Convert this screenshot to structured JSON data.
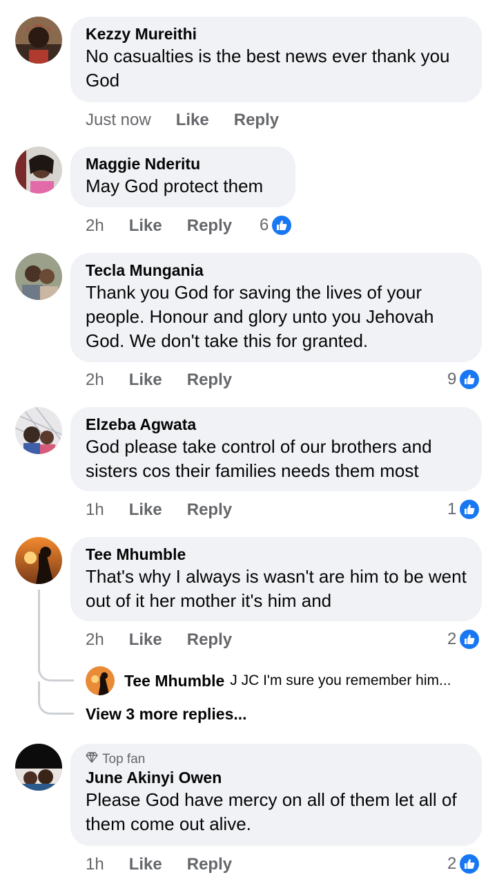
{
  "comments": [
    {
      "author": "Kezzy Mureithi",
      "text": "No casualties is the best news ever thank you God",
      "time": "Just now",
      "like_label": "Like",
      "reply_label": "Reply",
      "reactions": ""
    },
    {
      "author": "Maggie Nderitu",
      "text": "May God protect them",
      "time": "2h",
      "like_label": "Like",
      "reply_label": "Reply",
      "reactions": "6"
    },
    {
      "author": "Tecla Mungania",
      "text": "Thank you God for saving the lives of your people. Honour and glory unto you Jehovah God. We don't take this for granted.",
      "time": "2h",
      "like_label": "Like",
      "reply_label": "Reply",
      "reactions": "9"
    },
    {
      "author": "Elzeba Agwata",
      "text": "God please take control of our brothers and sisters cos their families needs them most",
      "time": "1h",
      "like_label": "Like",
      "reply_label": "Reply",
      "reactions": "1"
    },
    {
      "author": "Tee Mhumble",
      "text": "That's why I always is wasn't are him to be went out of it her mother it's him and",
      "time": "2h",
      "like_label": "Like",
      "reply_label": "Reply",
      "reactions": "2",
      "reply_preview": {
        "author": "Tee Mhumble",
        "text": "J JC I'm sure you remember him..."
      },
      "view_more": "View 3 more replies..."
    },
    {
      "badge": "Top fan",
      "author": "June Akinyi Owen",
      "text": "Please God have mercy on all of them let all of them come out alive.",
      "time": "1h",
      "like_label": "Like",
      "reply_label": "Reply",
      "reactions": "2"
    }
  ],
  "icons": {
    "like_badge": "thumbs-up-icon",
    "top_fan": "diamond-icon"
  },
  "colors": {
    "bubble": "#f0f2f5",
    "like_blue": "#1877f2",
    "meta_gray": "#65676b"
  }
}
